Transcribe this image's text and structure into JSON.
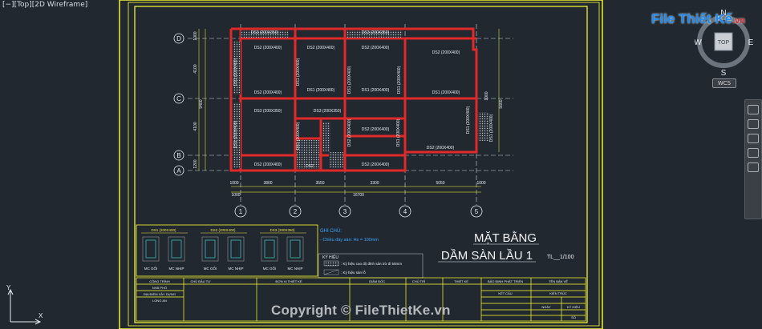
{
  "viewport": {
    "label": "[−][Top][2D Wireframe]"
  },
  "watermark": {
    "logo_file": "File",
    "logo_thiet_ke": "Thiết Kế",
    "logo_vn": ".vn",
    "copyright": "Copyright © FileThietKe.vn"
  },
  "viewcube": {
    "n": "N",
    "s": "S",
    "e": "E",
    "w": "W",
    "top": "TOP",
    "wcs": "WCS"
  },
  "ucs": {
    "x": "X",
    "y": "Y"
  },
  "drawing": {
    "title_line1": "MẶT BẰNG",
    "title_line2": "DẦM SÀN LẦU 1",
    "scale": "TL__1/100",
    "grid_rows": [
      "D",
      "C",
      "B",
      "A"
    ],
    "grid_cols": [
      "1",
      "2",
      "3",
      "4",
      "5"
    ],
    "dims_bottom": [
      "1000",
      "3800",
      "3550",
      "3300",
      "5050",
      "1000"
    ],
    "dim_total": "16700",
    "dims_left": [
      "1000",
      "4100",
      "9400",
      "4100",
      "1200"
    ],
    "dims_right": [
      "1000",
      "5600"
    ],
    "beams": [
      "DS3 (200X350)",
      "DS3 (200X350)",
      "DS2 (200X400)",
      "DS2 (200X400)",
      "DS2 (200X400)",
      "DS2 (200X400)",
      "DS2 (200X400)",
      "DS1 (200X400)",
      "DS1 (200X400)",
      "DS1 (200X400)",
      "DS1 (200X400)",
      "DS1 (200X400)",
      "DS3 (200X350)",
      "DS3 (200X350)",
      "DS1 (200X400)",
      "DS1 (200X400)",
      "DS2 (200X400)",
      "DS2 (200X400)",
      "DS2",
      "DS2 (200X400)",
      "DS2 (200X400)",
      "DS1 (200X400)",
      "DS1 (200X400)",
      "DS1 (200X400)",
      "DS1 (200X400)",
      "DS2 (200X400)",
      "DS1 (200X400)"
    ],
    "notes_title": "GHI CHÚ:",
    "notes_line": "- Chiều dày sàn: Hs = 100mm",
    "legend_title": "KÝ HIỆU",
    "legend_1": ": Ký hiệu cao độ đỉnh sàn trừ đi 50mm",
    "legend_2": ": Ký hiệu sàn lỗ",
    "sections": [
      {
        "title": "DS1",
        "spec": "(200X400)",
        "label_a": "MC GỐI",
        "label_b": "MC NHỊP"
      },
      {
        "title": "DS2",
        "spec": "(200X400)",
        "label_a": "MC GỐI",
        "label_b": "MC NHỊP"
      },
      {
        "title": "DS3",
        "spec": "(200X350)",
        "label_a": "MC GỐI",
        "label_b": "MC NHỊP"
      }
    ],
    "title_block": {
      "cong_trinh": "CÔNG TRÌNH",
      "chu_dau_tu": "CHỦ ĐẦU TƯ",
      "don_vi": "ĐƠN VỊ THIẾT KẾ",
      "giam_doc": "GIÁM ĐỐC",
      "chu_tri": "CHỦ TRÌ",
      "thiet_ke": "THIẾT KẾ",
      "phuong_an": "BẢO ĐỊNH PHÁT TRIỂN",
      "ten_ban_ve": "TÊN BẢN VẼ",
      "nha_pho": "NHÀ PHỐ",
      "dia_diem": "ĐỊA ĐIỂM XÂY DỰNG",
      "long_an": "LONG AN",
      "kien_truc": "KIẾN TRÚC",
      "ket_cau": "KẾT CẤU",
      "ngay": "NGÀY",
      "ky_hieu": "KÝ HIỆU",
      "so": "SỐ"
    }
  }
}
